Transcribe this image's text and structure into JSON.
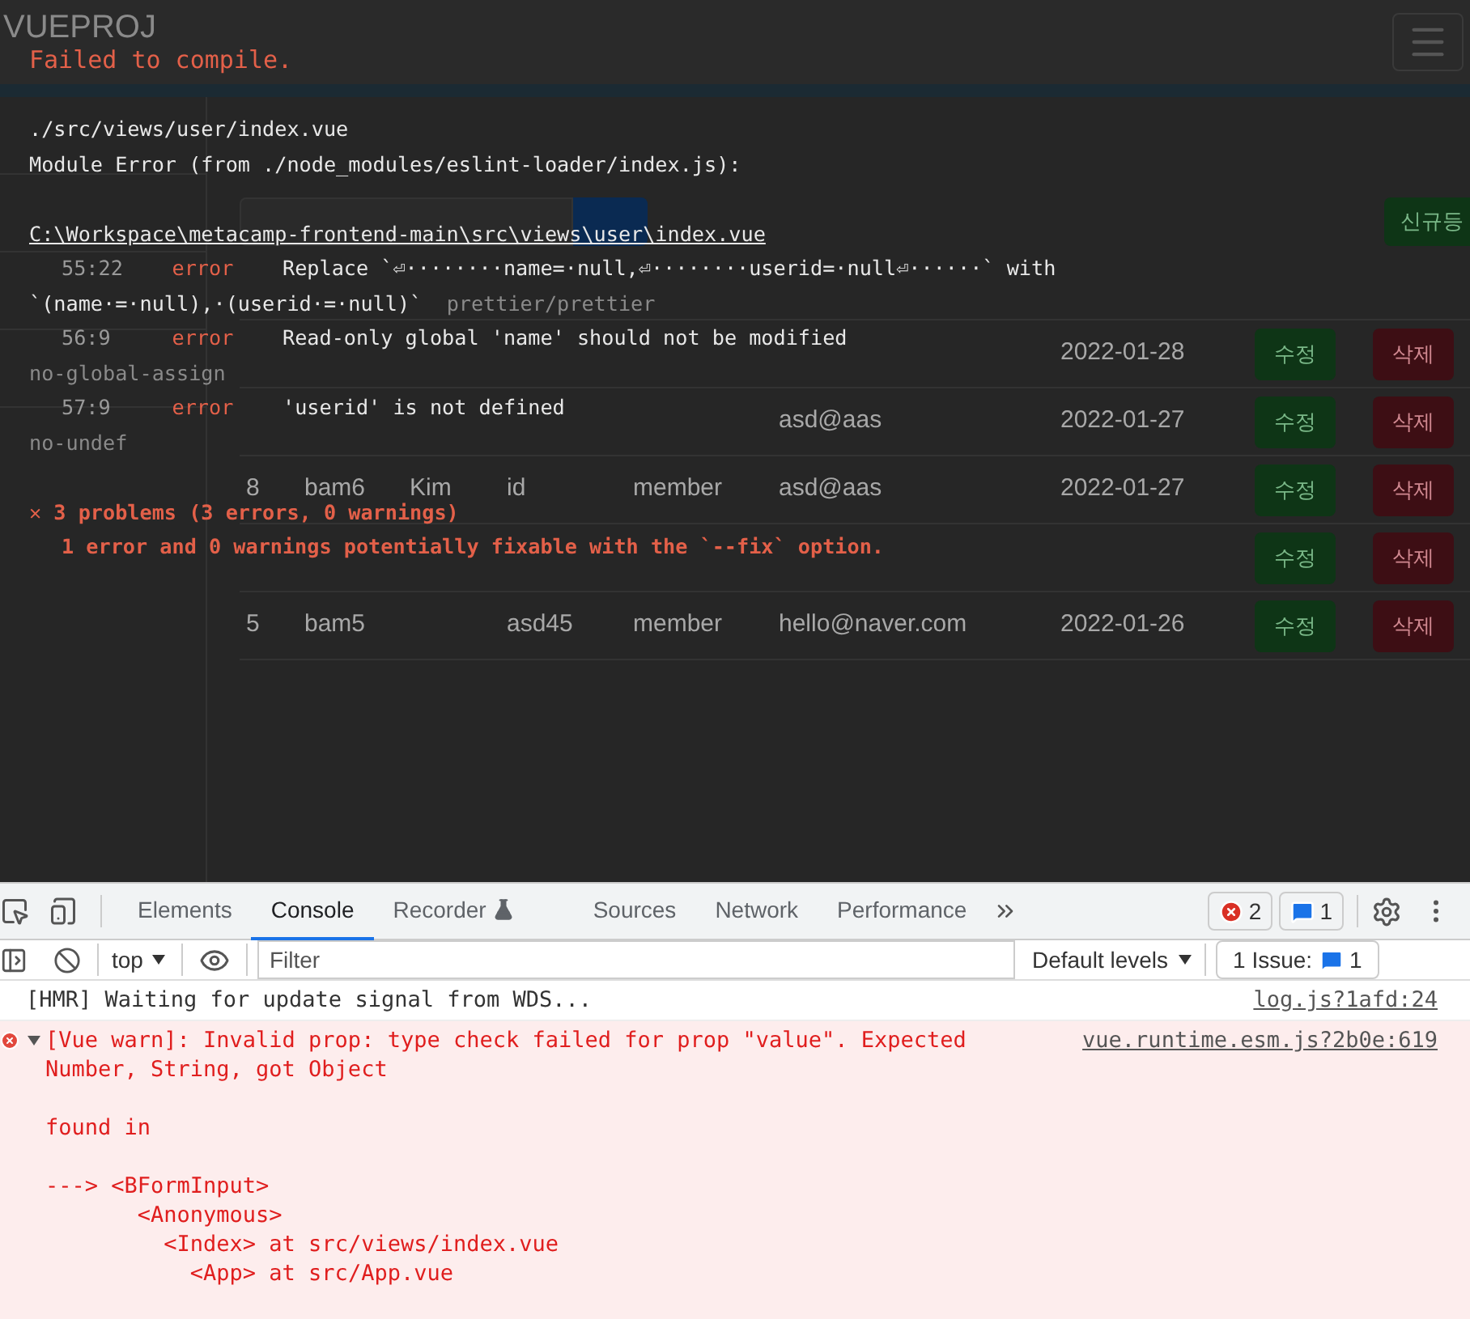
{
  "page": {
    "brand": "VUEPROJ",
    "new_button": "신규등",
    "table": {
      "rows": [
        {
          "cells": [
            null,
            null,
            null,
            null,
            null,
            null,
            "2022-01-28"
          ],
          "edit": "수정",
          "delete": "삭제"
        },
        {
          "cells": [
            null,
            null,
            null,
            null,
            null,
            "asd@aas",
            "2022-01-27"
          ],
          "edit": "수정",
          "delete": "삭제"
        },
        {
          "cells": [
            "8",
            "bam6",
            "Kim",
            "id",
            "member",
            "asd@aas",
            "2022-01-27"
          ],
          "edit": "수정",
          "delete": "삭제"
        },
        {
          "cells": [
            null,
            null,
            null,
            null,
            null,
            null,
            null
          ],
          "edit": "수정",
          "delete": "삭제"
        },
        {
          "cells": [
            "5",
            "bam5",
            null,
            "asd45",
            "member",
            "hello@naver.com",
            "2022-01-26"
          ],
          "edit": "수정",
          "delete": "삭제"
        }
      ]
    }
  },
  "overlay": {
    "title": "Failed to compile.",
    "file": "./src/views/user/index.vue",
    "module_error": "Module Error (from ./node_modules/eslint-loader/index.js):",
    "path": "C:\\Workspace\\metacamp-frontend-main\\src\\views\\user\\index.vue",
    "errors": [
      {
        "position": "55:22",
        "severity": "error",
        "message": "Replace `⏎········name=·null,⏎········userid=·null⏎······` with `(name·=·null),·(userid·=·null)`",
        "rule": "prettier/prettier"
      },
      {
        "position": "56:9",
        "severity": "error",
        "message": "Read-only global 'name' should not be modified",
        "rule": "no-global-assign"
      },
      {
        "position": "57:9",
        "severity": "error",
        "message": "'userid' is not defined",
        "rule": "no-undef"
      }
    ],
    "summary": "✕ 3 problems (3 errors, 0 warnings)",
    "fixable": "1 error and 0 warnings potentially fixable with the `--fix` option."
  },
  "devtools": {
    "tabs": [
      {
        "label": "Elements",
        "selected": false
      },
      {
        "label": "Console",
        "selected": true
      },
      {
        "label": "Recorder",
        "selected": false,
        "kind": "experimental"
      },
      {
        "label": "Sources",
        "selected": false
      },
      {
        "label": "Network",
        "selected": false
      },
      {
        "label": "Performance",
        "selected": false
      }
    ],
    "error_count": "2",
    "message_count": "1",
    "context": "top",
    "filter": {
      "placeholder": "Filter"
    },
    "levels": "Default levels",
    "issues": {
      "label": "1 Issue:",
      "count": "1"
    },
    "messages": [
      {
        "kind": "log",
        "text": "[HMR] Waiting for update signal from WDS...",
        "source": "log.js?1afd:24"
      },
      {
        "kind": "error",
        "expanded": true,
        "text": "[Vue warn]: Invalid prop: type check failed for prop \"value\". Expected Number, String, got Object\n\nfound in\n\n---> <BFormInput>\n       <Anonymous>\n         <Index> at src/views/index.vue\n           <App> at src/App.vue",
        "source": "vue.runtime.esm.js?2b0e:619"
      }
    ]
  }
}
